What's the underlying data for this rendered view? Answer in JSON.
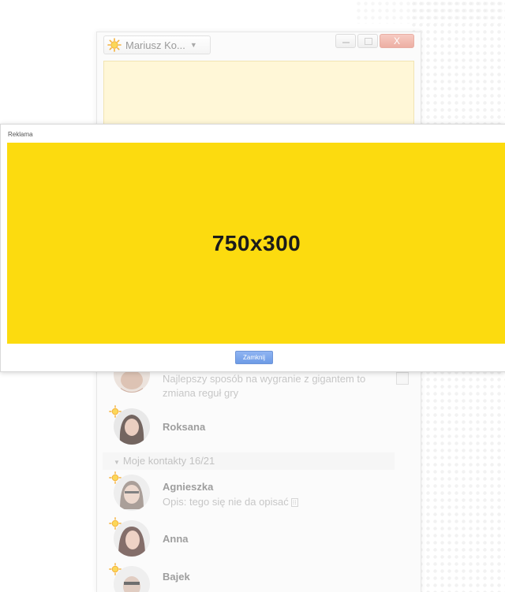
{
  "window": {
    "status_user": "Mariusz Ko...",
    "close_glyph": "X"
  },
  "ad": {
    "label": "Reklama",
    "banner_text": "750x300",
    "close_button": "Zamknij",
    "banner_color": "#fcdb0f"
  },
  "contacts": {
    "top_entry": {
      "desc": "Najlepszy sposób na wygranie z gigantem to zmiana reguł gry"
    },
    "group_header": "Moje kontakty 16/21",
    "items": [
      {
        "name": "Roksana"
      },
      {
        "name": "Agnieszka",
        "desc": "Opis: tego się nie da opisać"
      },
      {
        "name": "Anna"
      },
      {
        "name": "Bajek"
      }
    ]
  },
  "icons": [
    "sun-status-icon",
    "chevron-down-icon",
    "minimize-icon",
    "maximize-icon",
    "close-icon",
    "emoticon-icon"
  ]
}
